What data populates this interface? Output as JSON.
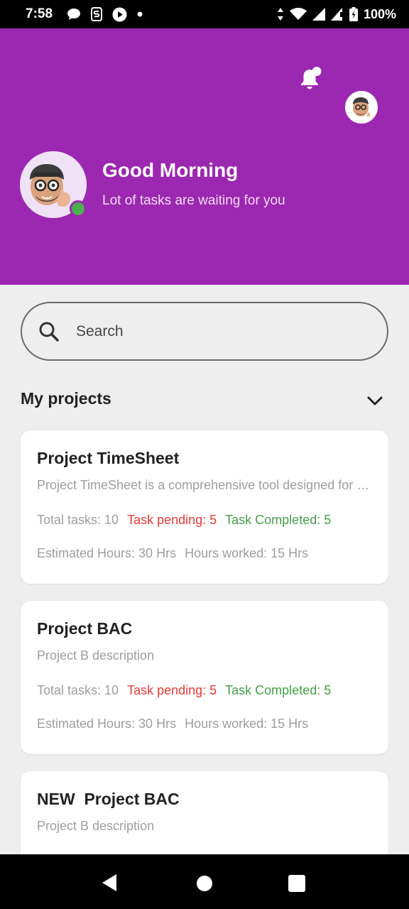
{
  "status_bar": {
    "time": "7:58",
    "left_icons": [
      "chat-bubble-icon",
      "s-app-icon",
      "play-icon",
      "dot-icon"
    ],
    "right_icons": [
      "data-arrows-icon",
      "wifi-icon",
      "signal-icon",
      "signal-alt-icon",
      "battery-icon"
    ],
    "battery": "100%"
  },
  "header": {
    "greeting": "Good Morning",
    "subtitle": "Lot of tasks are waiting for you",
    "background_color": "#9c27b0",
    "online_color": "#4caf50"
  },
  "search": {
    "placeholder": "Search"
  },
  "projects_section": {
    "title": "My projects"
  },
  "projects": [
    {
      "title": "Project TimeSheet",
      "description": "Project TimeSheet is a comprehensive tool designed for tracking",
      "total_tasks": "Total tasks: 10",
      "task_pending": "Task pending: 5",
      "task_completed": "Task Completed: 5",
      "estimated_hours": "Estimated Hours: 30 Hrs",
      "hours_worked": "Hours worked: 15 Hrs"
    },
    {
      "title": "Project BAC",
      "description": "Project B description",
      "total_tasks": "Total tasks: 10",
      "task_pending": "Task pending: 5",
      "task_completed": "Task Completed: 5",
      "estimated_hours": "Estimated Hours: 30 Hrs",
      "hours_worked": "Hours worked: 15 Hrs"
    },
    {
      "title": "NEW  Project BAC",
      "description": "Project B description"
    }
  ],
  "colors": {
    "pending": "#e53935",
    "completed": "#43a047",
    "muted": "#9e9e9e"
  }
}
